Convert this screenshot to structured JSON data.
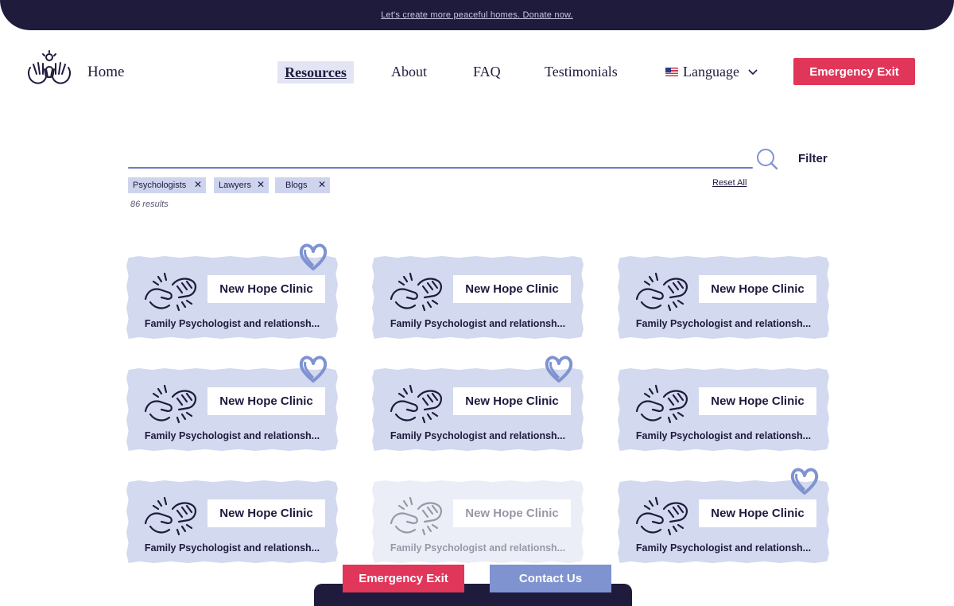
{
  "banner": {
    "text": "Let's create more peaceful homes. Donate now."
  },
  "nav": {
    "home": "Home",
    "resources": "Resources",
    "about": "About",
    "faq": "FAQ",
    "testimonials": "Testimonials",
    "language": "Language",
    "emergency_exit": "Emergency Exit"
  },
  "search": {
    "placeholder": "",
    "filter_label": "Filter"
  },
  "filters": {
    "chips": [
      "Psychologists",
      "Lawyers",
      "Blogs"
    ],
    "reset_label": "Reset All",
    "results_text": "86 results"
  },
  "cards": [
    {
      "name": "New Hope Clinic",
      "desc": "Family Psychologist and relationsh...",
      "favorited": true
    },
    {
      "name": "New Hope Clinic",
      "desc": "Family Psychologist and relationsh...",
      "favorited": false
    },
    {
      "name": "New Hope Clinic",
      "desc": "Family Psychologist and relationsh...",
      "favorited": false
    },
    {
      "name": "New Hope Clinic",
      "desc": "Family Psychologist and relationsh...",
      "favorited": true
    },
    {
      "name": "New Hope Clinic",
      "desc": "Family Psychologist and relationsh...",
      "favorited": true
    },
    {
      "name": "New Hope Clinic",
      "desc": "Family Psychologist and relationsh...",
      "favorited": false
    },
    {
      "name": "New Hope Clinic",
      "desc": "Family Psychologist and relationsh...",
      "favorited": false
    },
    {
      "name": "New Hope Clinic",
      "desc": "Family Psychologist and relationsh...",
      "favorited": false
    },
    {
      "name": "New Hope Clinic",
      "desc": "Family Psychologist and relationsh...",
      "favorited": true
    }
  ],
  "bottom": {
    "emergency_exit": "Emergency Exit",
    "contact": "Contact Us"
  },
  "colors": {
    "navy": "#1e1b3d",
    "accent_red": "#e0365a",
    "periwinkle": "#7f93d1",
    "card_bg": "#d3d9ee"
  }
}
